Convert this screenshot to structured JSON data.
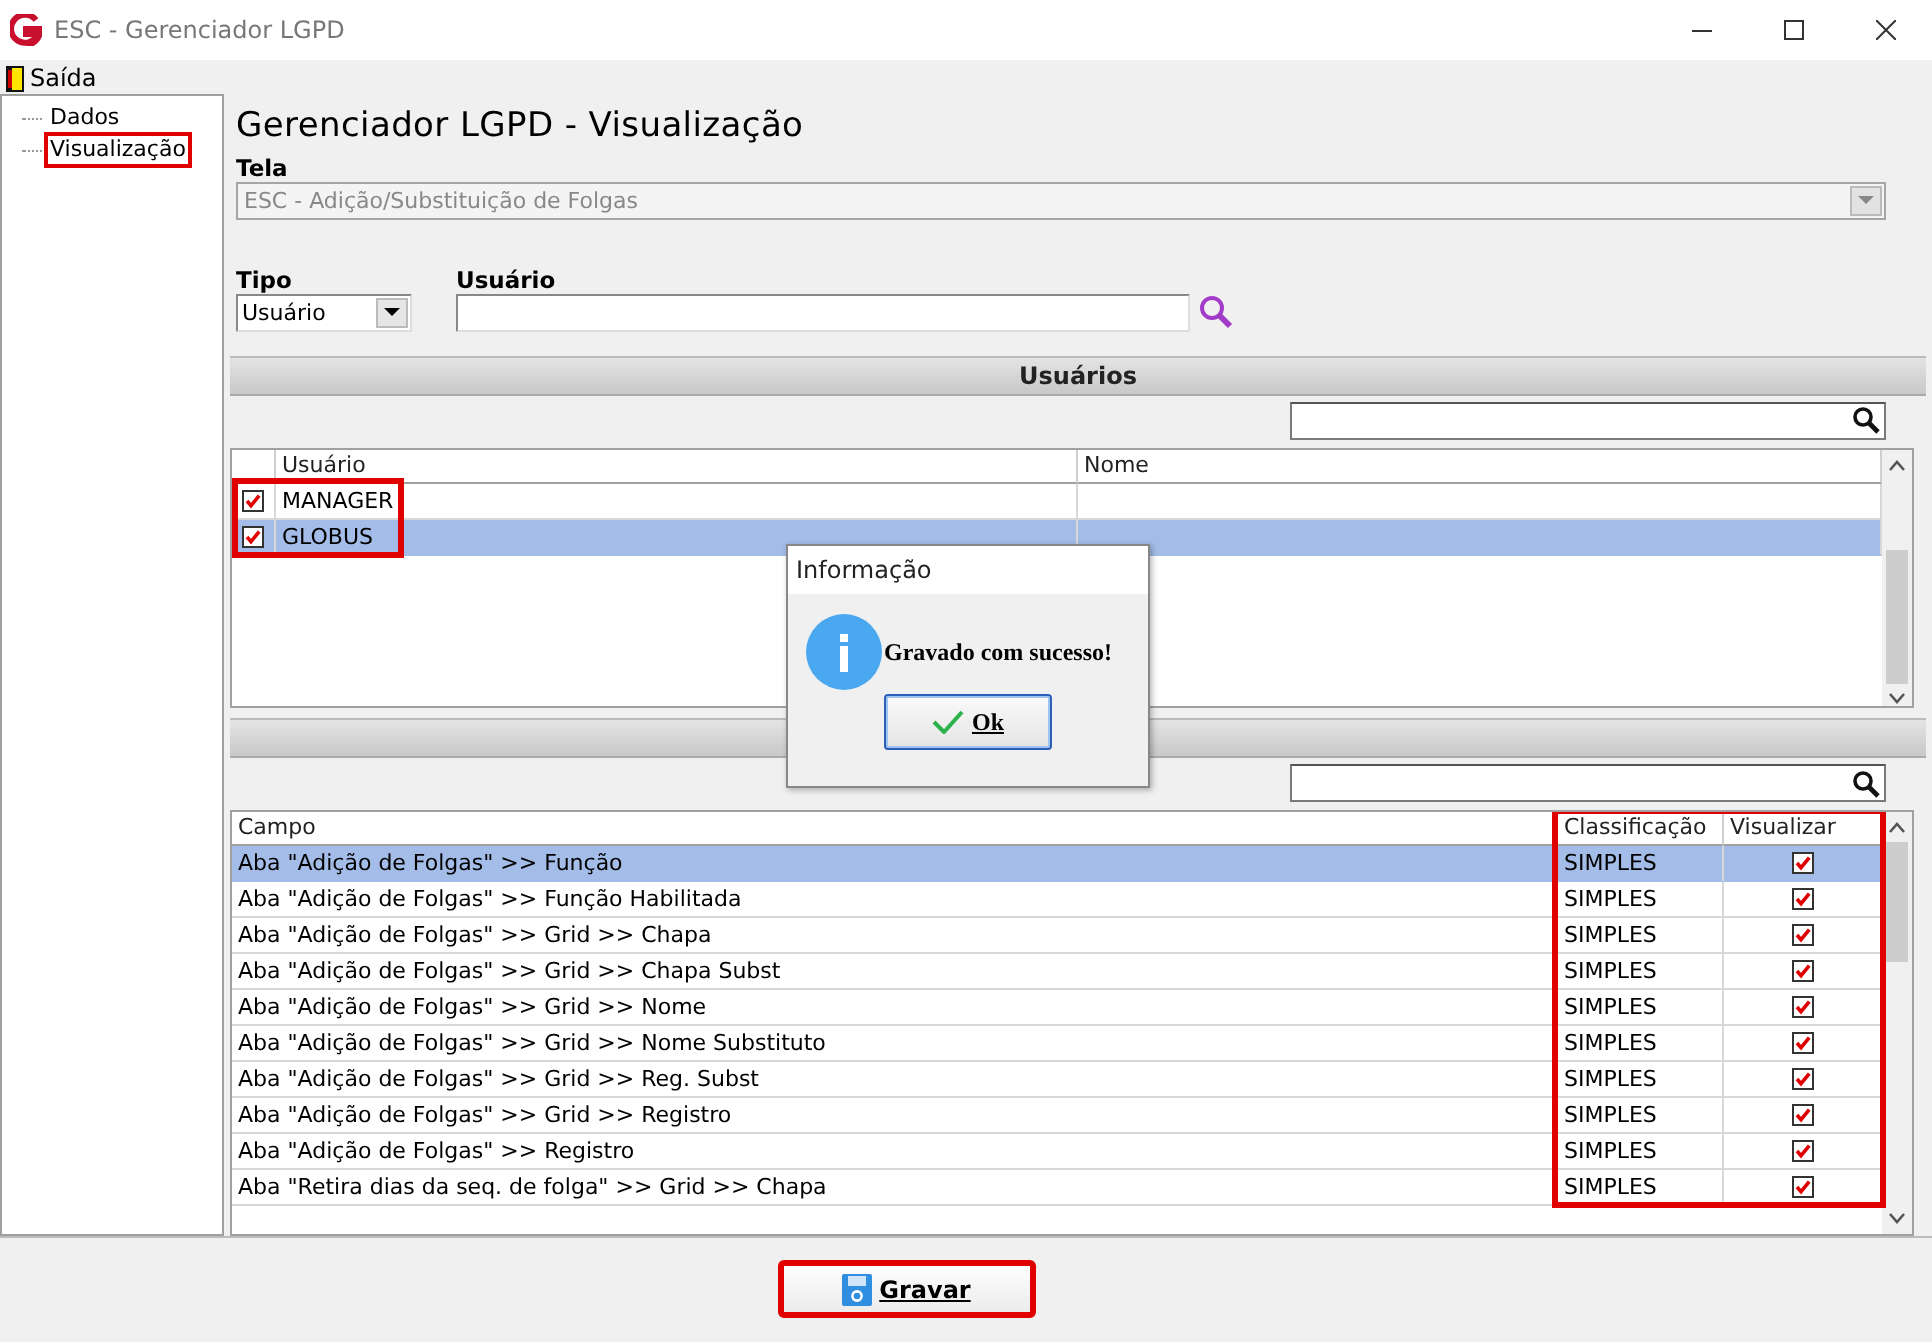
{
  "window": {
    "title": "ESC - Gerenciador LGPD"
  },
  "menu": [
    {
      "label": "Saída"
    }
  ],
  "tree": [
    {
      "label": "Dados",
      "selected": false,
      "highlighted": false
    },
    {
      "label": "Visualização",
      "selected": false,
      "highlighted": true
    }
  ],
  "heading": "Gerenciador LGPD - Visualização",
  "tela": {
    "label": "Tela",
    "value": "ESC -  Adição/Substituição de Folgas",
    "disabled": true
  },
  "tipo": {
    "label": "Tipo",
    "value": "Usuário"
  },
  "usuario": {
    "label": "Usuário"
  },
  "users_section": {
    "title": "Usuários",
    "columns": [
      "Usuário",
      "Nome"
    ],
    "highlighted": true,
    "rows": [
      {
        "checked": true,
        "usuario": "MANAGER",
        "nome": "",
        "selected": false
      },
      {
        "checked": true,
        "usuario": "GLOBUS",
        "nome": "",
        "selected": true
      }
    ]
  },
  "fields_section": {
    "columns": [
      "Campo",
      "Classificação",
      "Visualizar"
    ],
    "highlighted": true,
    "rows": [
      {
        "campo": "Aba \"Adição de Folgas\" >> Função",
        "classificacao": "SIMPLES",
        "checked": true,
        "selected": true
      },
      {
        "campo": "Aba \"Adição de Folgas\" >> Função Habilitada",
        "classificacao": "SIMPLES",
        "checked": true,
        "selected": false
      },
      {
        "campo": "Aba \"Adição de Folgas\" >> Grid >> Chapa",
        "classificacao": "SIMPLES",
        "checked": true,
        "selected": false
      },
      {
        "campo": "Aba \"Adição de Folgas\" >> Grid >> Chapa Subst",
        "classificacao": "SIMPLES",
        "checked": true,
        "selected": false
      },
      {
        "campo": "Aba \"Adição de Folgas\" >> Grid >> Nome",
        "classificacao": "SIMPLES",
        "checked": true,
        "selected": false
      },
      {
        "campo": "Aba \"Adição de Folgas\" >> Grid >> Nome Substituto",
        "classificacao": "SIMPLES",
        "checked": true,
        "selected": false
      },
      {
        "campo": "Aba \"Adição de Folgas\" >> Grid >> Reg. Subst",
        "classificacao": "SIMPLES",
        "checked": true,
        "selected": false
      },
      {
        "campo": "Aba \"Adição de Folgas\" >> Grid >> Registro",
        "classificacao": "SIMPLES",
        "checked": true,
        "selected": false
      },
      {
        "campo": "Aba \"Adição de Folgas\" >> Registro",
        "classificacao": "SIMPLES",
        "checked": true,
        "selected": false
      },
      {
        "campo": "Aba \"Retira dias da seq. de folga\" >> Grid >> Chapa",
        "classificacao": "SIMPLES",
        "checked": true,
        "selected": false
      }
    ]
  },
  "save_button": {
    "label": "Gravar",
    "highlighted": true
  },
  "dialog": {
    "title": "Informação",
    "message": "Gravado com sucesso!",
    "button": "Ok"
  }
}
